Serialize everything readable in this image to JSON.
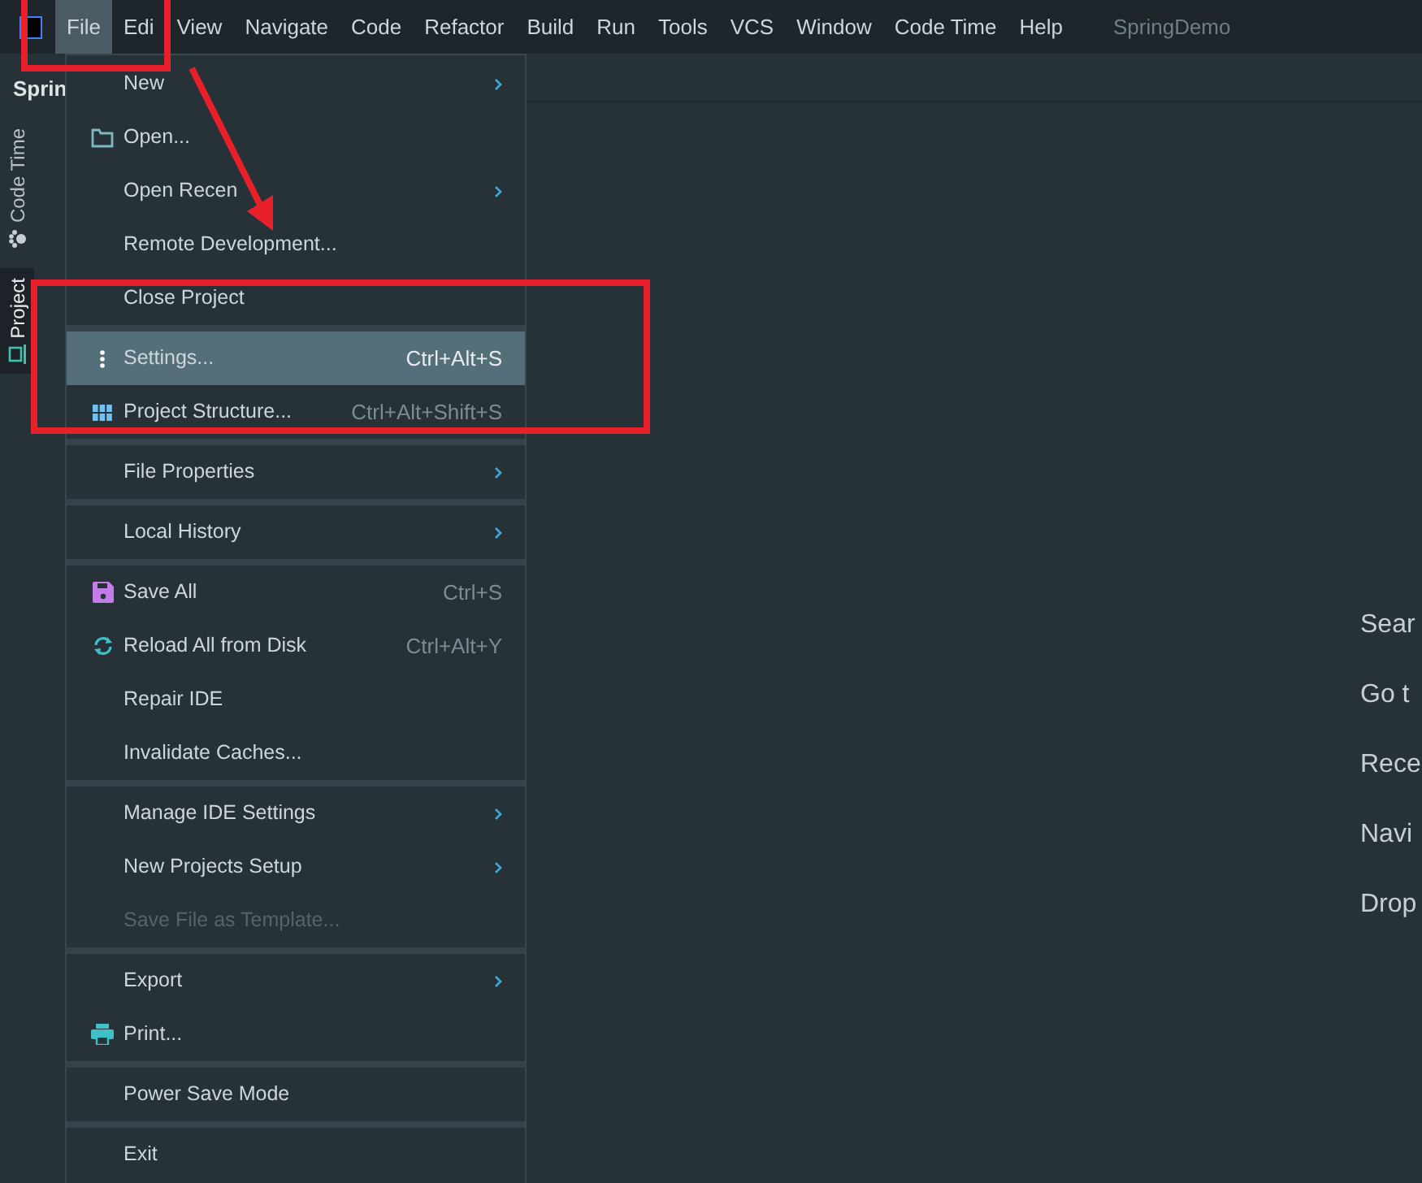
{
  "menubar": [
    {
      "label": "File",
      "selected": true
    },
    {
      "label": "Edi",
      "selected": false
    },
    {
      "label": "View",
      "selected": false
    },
    {
      "label": "Navigate",
      "selected": false
    },
    {
      "label": "Code",
      "selected": false
    },
    {
      "label": "Refactor",
      "selected": false
    },
    {
      "label": "Build",
      "selected": false
    },
    {
      "label": "Run",
      "selected": false
    },
    {
      "label": "Tools",
      "selected": false
    },
    {
      "label": "VCS",
      "selected": false
    },
    {
      "label": "Window",
      "selected": false
    },
    {
      "label": "Code Time",
      "selected": false
    },
    {
      "label": "Help",
      "selected": false
    }
  ],
  "project_name": "SpringDemo",
  "panel_title": "Sprin",
  "tool_tabs": [
    {
      "label": "Code Time",
      "selected": false
    },
    {
      "label": "Project",
      "selected": true
    }
  ],
  "file_menu": [
    {
      "kind": "item",
      "label": "New",
      "submenu": true,
      "selected": false,
      "disabled": false
    },
    {
      "kind": "item",
      "label": "Open...",
      "submenu": false,
      "selected": false,
      "disabled": false
    },
    {
      "kind": "item",
      "label": "Open Recen",
      "submenu": true,
      "selected": false,
      "disabled": false
    },
    {
      "kind": "item",
      "label": "Remote Development...",
      "submenu": false,
      "selected": false,
      "disabled": false
    },
    {
      "kind": "item",
      "label": "Close Project",
      "submenu": false,
      "selected": false,
      "disabled": false
    },
    {
      "kind": "separator"
    },
    {
      "kind": "item",
      "label": "Settings...",
      "shortcut": "Ctrl+Alt+S",
      "submenu": false,
      "selected": true,
      "disabled": false
    },
    {
      "kind": "item",
      "label": "Project Structure...",
      "shortcut": "Ctrl+Alt+Shift+S",
      "submenu": false,
      "selected": false,
      "disabled": false
    },
    {
      "kind": "separator"
    },
    {
      "kind": "item",
      "label": "File Properties",
      "submenu": true,
      "selected": false,
      "disabled": false
    },
    {
      "kind": "separator"
    },
    {
      "kind": "item",
      "label": "Local History",
      "submenu": true,
      "selected": false,
      "disabled": false
    },
    {
      "kind": "separator"
    },
    {
      "kind": "item",
      "label": "Save All",
      "shortcut": "Ctrl+S",
      "submenu": false,
      "selected": false,
      "disabled": false
    },
    {
      "kind": "item",
      "label": "Reload All from Disk",
      "shortcut": "Ctrl+Alt+Y",
      "submenu": false,
      "selected": false,
      "disabled": false
    },
    {
      "kind": "item",
      "label": "Repair IDE",
      "submenu": false,
      "selected": false,
      "disabled": false
    },
    {
      "kind": "item",
      "label": "Invalidate Caches...",
      "submenu": false,
      "selected": false,
      "disabled": false
    },
    {
      "kind": "separator"
    },
    {
      "kind": "item",
      "label": "Manage IDE Settings",
      "submenu": true,
      "selected": false,
      "disabled": false
    },
    {
      "kind": "item",
      "label": "New Projects Setup",
      "submenu": true,
      "selected": false,
      "disabled": false
    },
    {
      "kind": "item",
      "label": "Save File as Template...",
      "submenu": false,
      "selected": false,
      "disabled": true
    },
    {
      "kind": "separator"
    },
    {
      "kind": "item",
      "label": "Export",
      "submenu": true,
      "selected": false,
      "disabled": false
    },
    {
      "kind": "item",
      "label": "Print...",
      "submenu": false,
      "selected": false,
      "disabled": false
    },
    {
      "kind": "separator"
    },
    {
      "kind": "item",
      "label": "Power Save Mode",
      "submenu": false,
      "selected": false,
      "disabled": false
    },
    {
      "kind": "separator"
    },
    {
      "kind": "item",
      "label": "Exit",
      "submenu": false,
      "selected": false,
      "disabled": false
    }
  ],
  "welcome_hints": [
    "Sear",
    "Go t",
    "Rece",
    "Navi",
    "Drop"
  ]
}
